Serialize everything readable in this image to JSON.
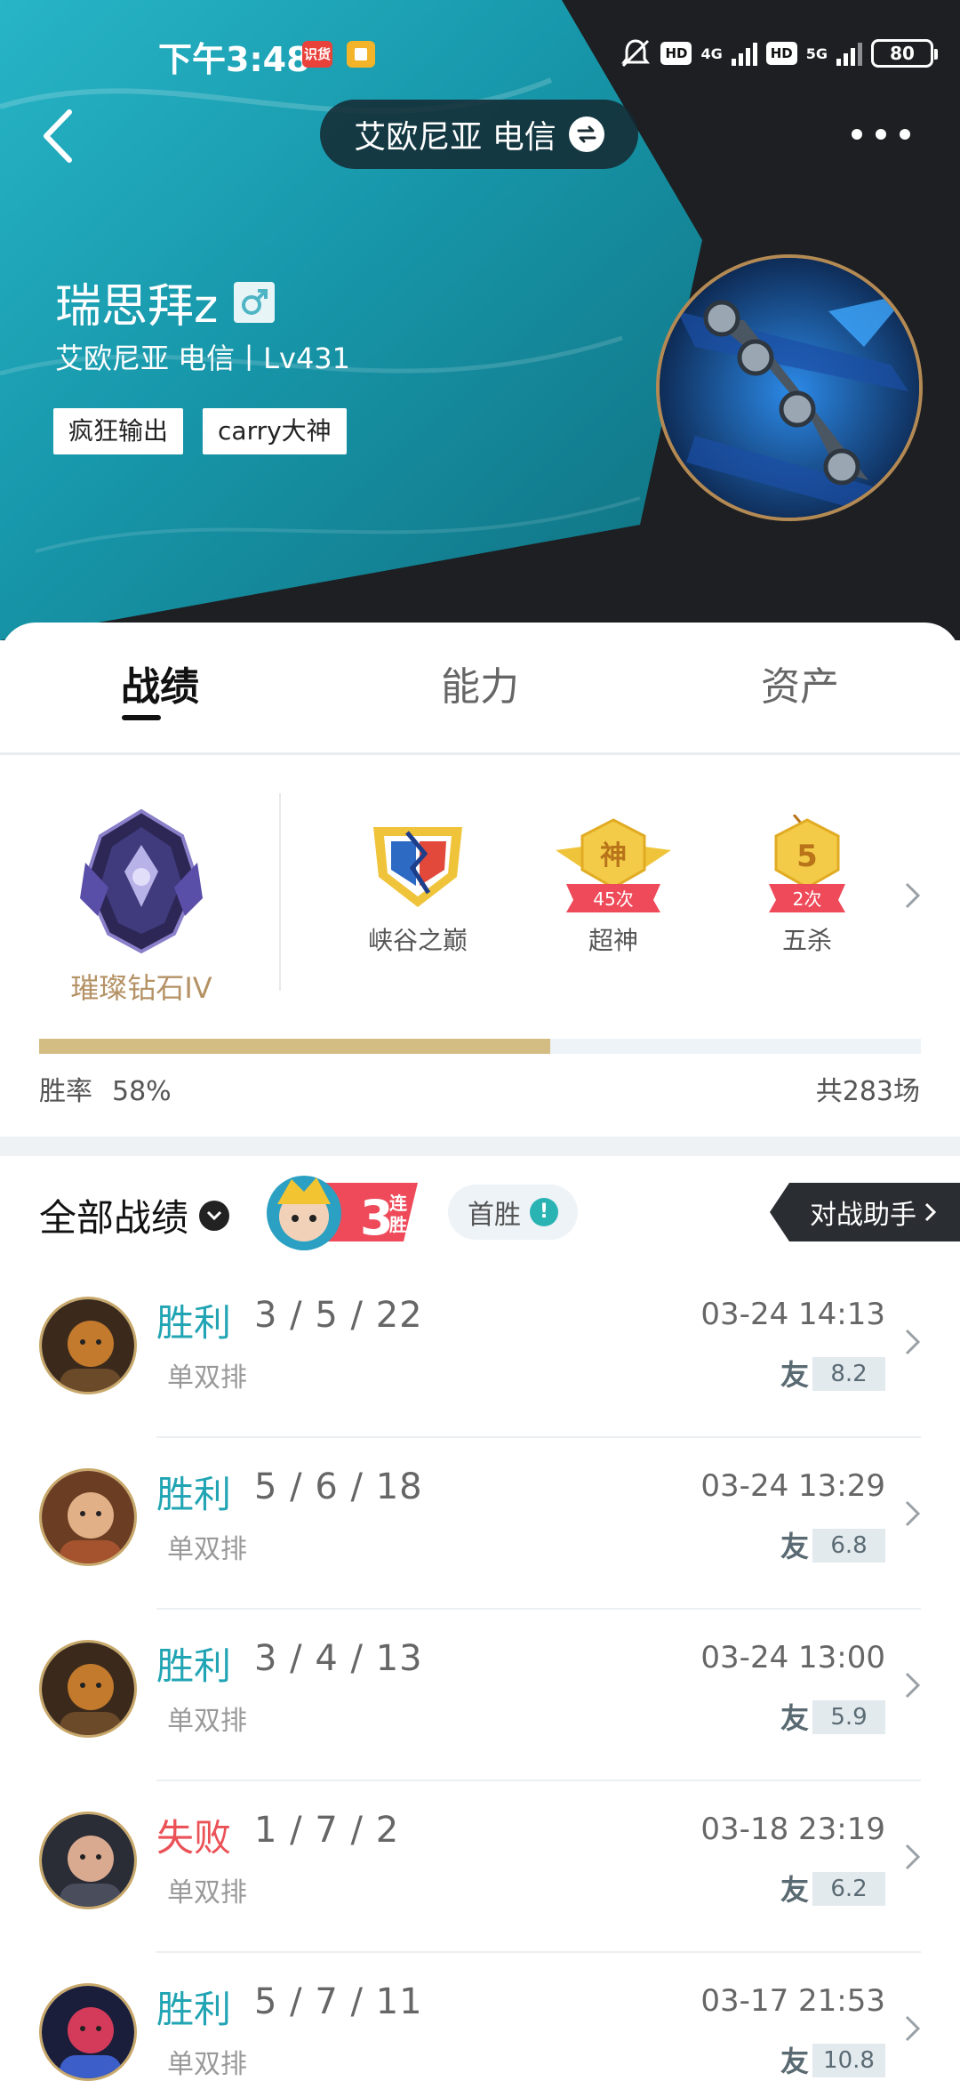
{
  "status_bar": {
    "time": "下午3:48",
    "badge_text": "识货",
    "net1": "4G",
    "net2": "5G",
    "hd": "HD",
    "battery": "80"
  },
  "header": {
    "server": "艾欧尼亚 电信",
    "player_name": "瑞思拜z",
    "player_sub": "艾欧尼亚 电信丨Lv431",
    "tags": [
      "疯狂输出",
      "carry大神"
    ]
  },
  "tabs": [
    {
      "label": "战绩",
      "active": true
    },
    {
      "label": "能力",
      "active": false
    },
    {
      "label": "资产",
      "active": false
    }
  ],
  "rank": {
    "name": "璀璨钻石IV"
  },
  "honors": [
    {
      "label": "峡谷之巅",
      "badge": ""
    },
    {
      "label": "超神",
      "badge": "45次",
      "emblem": "神"
    },
    {
      "label": "五杀",
      "badge": "2次",
      "emblem": "5"
    }
  ],
  "winrate": {
    "label": "胜率",
    "value_text": "58%",
    "value": 0.58,
    "total": "共283场"
  },
  "filters": {
    "title": "全部战绩",
    "streak_number": "3",
    "streak_text_top": "连",
    "streak_text_bottom": "胜",
    "first_win": "首胜",
    "first_win_info": "!",
    "assistant": "对战助手"
  },
  "matches": [
    {
      "result": "胜利",
      "win": true,
      "kda": "3 / 5 / 22",
      "mode": "单双排",
      "time": "03-24 14:13",
      "score": "8.2"
    },
    {
      "result": "胜利",
      "win": true,
      "kda": "5 / 6 / 18",
      "mode": "单双排",
      "time": "03-24 13:29",
      "score": "6.8"
    },
    {
      "result": "胜利",
      "win": true,
      "kda": "3 / 4 / 13",
      "mode": "单双排",
      "time": "03-24 13:00",
      "score": "5.9"
    },
    {
      "result": "失败",
      "win": false,
      "kda": "1 / 7 / 2",
      "mode": "单双排",
      "time": "03-18 23:19",
      "score": "6.2"
    },
    {
      "result": "胜利",
      "win": true,
      "kda": "5 / 7 / 11",
      "mode": "单双排",
      "time": "03-17 21:53",
      "score": "10.8"
    }
  ],
  "friend_glyph": "友",
  "colors": {
    "win": "#21a4b3",
    "loss": "#ea5257",
    "rank_gold": "#b49265",
    "winrate_bar": "#d4bd83",
    "header_teal": "#19a3b5",
    "header_dark": "#1d1f22"
  }
}
